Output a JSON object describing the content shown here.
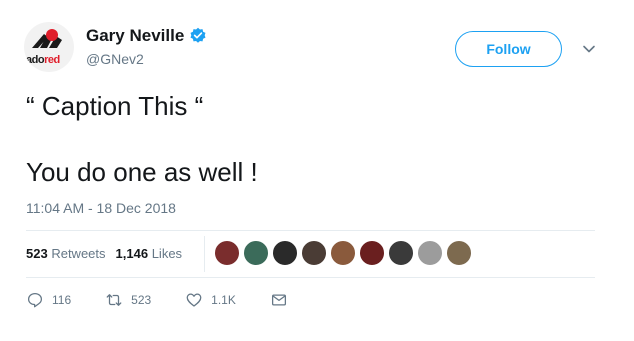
{
  "user": {
    "display_name": "Gary Neville",
    "handle": "@GNev2",
    "verified": true,
    "avatar_text_part1": "ado",
    "avatar_text_part2": "red"
  },
  "follow_label": "Follow",
  "tweet": {
    "line1": "“ Caption This “",
    "line2": "You do one as well !",
    "timestamp": "11:04 AM - 18 Dec 2018"
  },
  "stats": {
    "retweets_count": "523",
    "retweets_label": "Retweets",
    "likes_count": "1,146",
    "likes_label": "Likes"
  },
  "likers": [
    {
      "color": "#7a2d2d"
    },
    {
      "color": "#3b6b5a"
    },
    {
      "color": "#2a2a2a"
    },
    {
      "color": "#4a3c35"
    },
    {
      "color": "#8a5a3c"
    },
    {
      "color": "#6a1f1f"
    },
    {
      "color": "#3a3a3a"
    },
    {
      "color": "#9c9c9c"
    },
    {
      "color": "#7d6a4f"
    }
  ],
  "actions": {
    "reply_count": "116",
    "retweet_count": "523",
    "like_count": "1.1K"
  },
  "colors": {
    "accent": "#1da1f2",
    "muted": "#657786",
    "text": "#14171a"
  }
}
